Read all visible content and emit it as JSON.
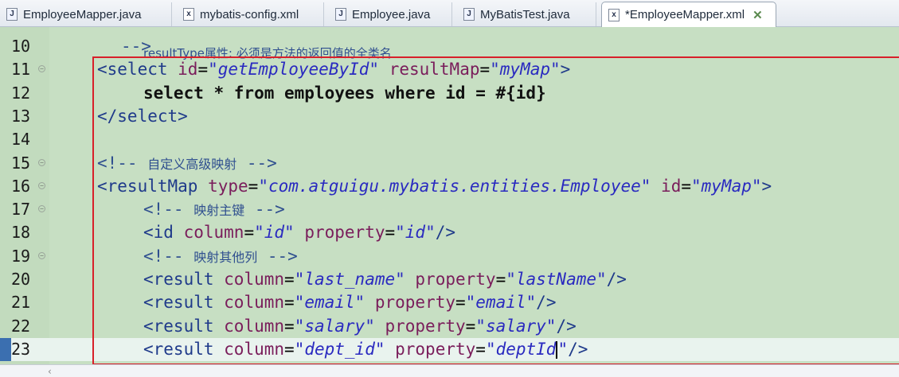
{
  "tabs": [
    {
      "label": "EmployeeMapper.java",
      "icon": "java-file-icon"
    },
    {
      "label": "mybatis-config.xml",
      "icon": "xml-file-icon"
    },
    {
      "label": "Employee.java",
      "icon": "java-file-icon"
    },
    {
      "label": "MyBatisTest.java",
      "icon": "java-file-icon"
    },
    {
      "label": "*EmployeeMapper.xml",
      "icon": "xml-file-icon",
      "active": true,
      "close_icon": "close-tab-icon"
    }
  ],
  "editor": {
    "partial_top_line": "resultType属性: 必须是方法的返回值的全类名",
    "lines": [
      {
        "num": "10",
        "parts": [
          {
            "t": "-->",
            "c": "cm"
          }
        ]
      },
      {
        "num": "11",
        "fold": true,
        "parts": [
          {
            "t": "<select",
            "c": "tg"
          },
          {
            "t": " id",
            "c": "an"
          },
          {
            "t": "=",
            "c": "eq"
          },
          {
            "t": "\"getEmployeeById\"",
            "c": "av"
          },
          {
            "t": " resultMap",
            "c": "an"
          },
          {
            "t": "=",
            "c": "eq"
          },
          {
            "t": "\"myMap\"",
            "c": "av"
          },
          {
            "t": ">",
            "c": "tg"
          }
        ]
      },
      {
        "num": "12",
        "parts": [
          {
            "t": "select * from employees where id = #{id}",
            "c": "sq"
          }
        ]
      },
      {
        "num": "13",
        "parts": [
          {
            "t": "</select>",
            "c": "tg"
          }
        ]
      },
      {
        "num": "14",
        "parts": []
      },
      {
        "num": "15",
        "fold": true,
        "parts": [
          {
            "t": "<!-- ",
            "c": "cm"
          },
          {
            "t": "自定义高级映射",
            "c": "cm-cn"
          },
          {
            "t": " -->",
            "c": "cm"
          }
        ]
      },
      {
        "num": "16",
        "fold": true,
        "parts": [
          {
            "t": "<resultMap",
            "c": "tg"
          },
          {
            "t": " type",
            "c": "an"
          },
          {
            "t": "=",
            "c": "eq"
          },
          {
            "t": "\"com.atguigu.mybatis.entities.Employee\"",
            "c": "av"
          },
          {
            "t": " id",
            "c": "an"
          },
          {
            "t": "=",
            "c": "eq"
          },
          {
            "t": "\"myMap\"",
            "c": "av"
          },
          {
            "t": ">",
            "c": "tg"
          }
        ]
      },
      {
        "num": "17",
        "fold": true,
        "parts": [
          {
            "t": "<!-- ",
            "c": "cm"
          },
          {
            "t": "映射主键",
            "c": "cm-cn"
          },
          {
            "t": " -->",
            "c": "cm"
          }
        ]
      },
      {
        "num": "18",
        "parts": [
          {
            "t": "<id",
            "c": "tg"
          },
          {
            "t": " column",
            "c": "an"
          },
          {
            "t": "=",
            "c": "eq"
          },
          {
            "t": "\"id\"",
            "c": "av"
          },
          {
            "t": " property",
            "c": "an"
          },
          {
            "t": "=",
            "c": "eq"
          },
          {
            "t": "\"id\"",
            "c": "av"
          },
          {
            "t": "/>",
            "c": "tg"
          }
        ]
      },
      {
        "num": "19",
        "fold": true,
        "parts": [
          {
            "t": "<!-- ",
            "c": "cm"
          },
          {
            "t": "映射其他列",
            "c": "cm-cn"
          },
          {
            "t": " -->",
            "c": "cm"
          }
        ]
      },
      {
        "num": "20",
        "parts": [
          {
            "t": "<result",
            "c": "tg"
          },
          {
            "t": " column",
            "c": "an"
          },
          {
            "t": "=",
            "c": "eq"
          },
          {
            "t": "\"last_name\"",
            "c": "av"
          },
          {
            "t": " property",
            "c": "an"
          },
          {
            "t": "=",
            "c": "eq"
          },
          {
            "t": "\"lastName\"",
            "c": "av"
          },
          {
            "t": "/>",
            "c": "tg"
          }
        ]
      },
      {
        "num": "21",
        "parts": [
          {
            "t": "<result",
            "c": "tg"
          },
          {
            "t": " column",
            "c": "an"
          },
          {
            "t": "=",
            "c": "eq"
          },
          {
            "t": "\"email\"",
            "c": "av"
          },
          {
            "t": " property",
            "c": "an"
          },
          {
            "t": "=",
            "c": "eq"
          },
          {
            "t": "\"email\"",
            "c": "av"
          },
          {
            "t": "/>",
            "c": "tg"
          }
        ]
      },
      {
        "num": "22",
        "parts": [
          {
            "t": "<result",
            "c": "tg"
          },
          {
            "t": " column",
            "c": "an"
          },
          {
            "t": "=",
            "c": "eq"
          },
          {
            "t": "\"salary\"",
            "c": "av"
          },
          {
            "t": " property",
            "c": "an"
          },
          {
            "t": "=",
            "c": "eq"
          },
          {
            "t": "\"salary\"",
            "c": "av"
          },
          {
            "t": "/>",
            "c": "tg"
          }
        ]
      },
      {
        "num": "23",
        "current": true,
        "parts": [
          {
            "t": "<result",
            "c": "tg"
          },
          {
            "t": " column",
            "c": "an"
          },
          {
            "t": "=",
            "c": "eq"
          },
          {
            "t": "\"dept_id\"",
            "c": "av"
          },
          {
            "t": " property",
            "c": "an"
          },
          {
            "t": "=",
            "c": "eq"
          },
          {
            "t": "\"deptId",
            "c": "av"
          },
          {
            "t": "CURSOR",
            "c": "cursor"
          },
          {
            "t": "\"",
            "c": "av"
          },
          {
            "t": "/>",
            "c": "tg"
          }
        ]
      }
    ]
  },
  "colors": {
    "editor_bg": "#c7dfc3",
    "current_line_bg": "#e9f3ee",
    "highlight_box": "#d8202a",
    "tag": "#1f3a8a",
    "attr_name": "#7a1d5b",
    "attr_value": "#2a2ac0"
  },
  "scrollbar": {
    "left_arrow": "‹"
  }
}
